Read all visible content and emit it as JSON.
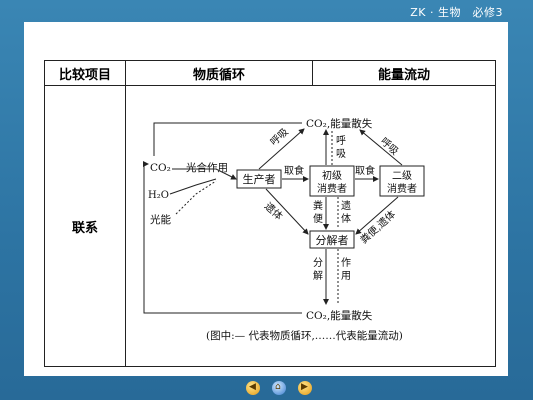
{
  "header": {
    "text": "ZK · 生物　必修3"
  },
  "table": {
    "headers": [
      "比较项目",
      "物质循环",
      "能量流动"
    ],
    "row_label": "联系"
  },
  "diagram": {
    "co2_top": "CO₂,能量散失",
    "co2_bottom": "CO₂,能量散失",
    "co2_left": "CO₂",
    "h2o": "H₂O",
    "light": "光能",
    "photosynthesis": "光合作用",
    "producer": "生产者",
    "primary_line1": "初级",
    "primary_line2": "消费者",
    "secondary_line1": "二级",
    "secondary_line2": "消费者",
    "decomposer": "分解者",
    "eat1": "取食",
    "eat2": "取食",
    "resp_producer": "呼吸",
    "resp_primary_1": "呼",
    "resp_primary_2": "吸",
    "resp_secondary": "呼吸",
    "remains_producer": "遗体",
    "feces_1": "粪",
    "feces_2": "便",
    "remains_primary_1": "遗",
    "remains_primary_2": "体",
    "feces_remains_secondary": "粪便,遗体",
    "decompose_1": "分",
    "decompose_2": "解",
    "action_1": "作",
    "action_2": "用",
    "caption": "(图中:— 代表物质循环,……代表能量流动)"
  }
}
